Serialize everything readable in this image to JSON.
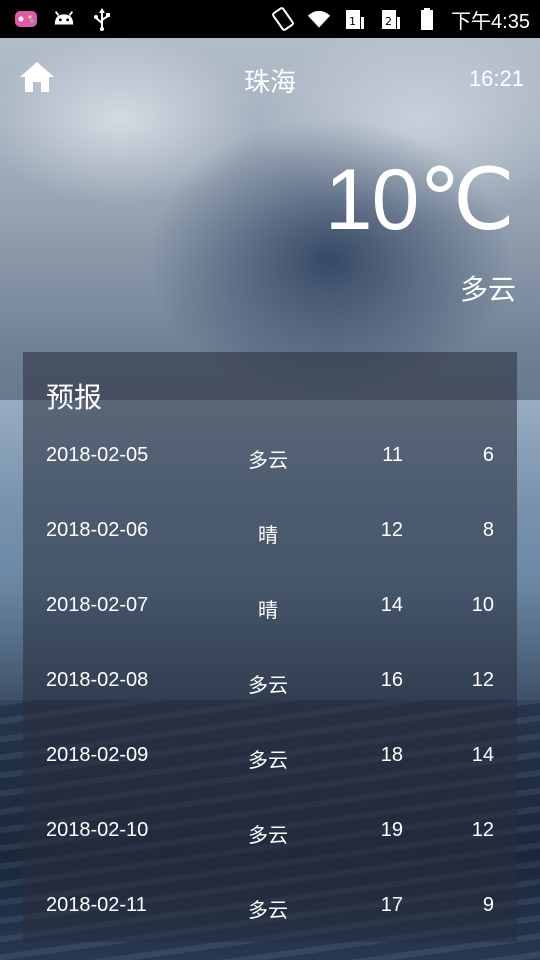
{
  "status_bar": {
    "left_icons": [
      "game-icon",
      "android-icon",
      "usb-icon"
    ],
    "right_icons": [
      "rotate-icon",
      "wifi-icon",
      "sim1-signal-icon",
      "sim2-signal-icon",
      "battery-icon"
    ],
    "time": "下午4:35"
  },
  "header": {
    "city": "珠海",
    "update_time": "16:21"
  },
  "now": {
    "temperature": "10℃",
    "condition": "多云"
  },
  "forecast": {
    "title": "预报",
    "items": [
      {
        "date": "2018-02-05",
        "info": "多云",
        "max": "11",
        "min": "6"
      },
      {
        "date": "2018-02-06",
        "info": "晴",
        "max": "12",
        "min": "8"
      },
      {
        "date": "2018-02-07",
        "info": "晴",
        "max": "14",
        "min": "10"
      },
      {
        "date": "2018-02-08",
        "info": "多云",
        "max": "16",
        "min": "12"
      },
      {
        "date": "2018-02-09",
        "info": "多云",
        "max": "18",
        "min": "14"
      },
      {
        "date": "2018-02-10",
        "info": "多云",
        "max": "19",
        "min": "12"
      },
      {
        "date": "2018-02-11",
        "info": "多云",
        "max": "17",
        "min": "9"
      }
    ]
  }
}
